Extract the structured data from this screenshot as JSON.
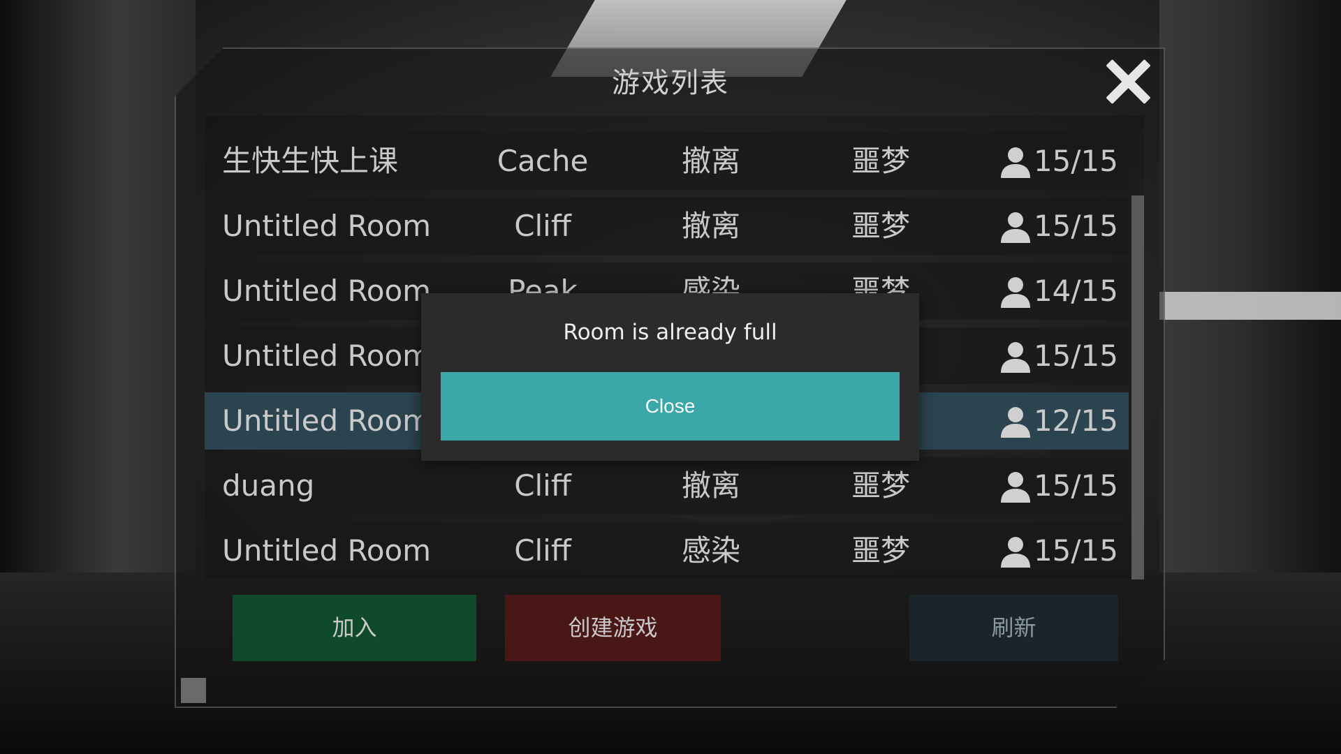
{
  "panel": {
    "title": "游戏列表"
  },
  "rooms": [
    {
      "name": "生快生快上课",
      "map": "Cache",
      "mode": "撤离",
      "difficulty": "噩梦",
      "players": "15/15",
      "selected": false
    },
    {
      "name": "Untitled Room",
      "map": "Cliff",
      "mode": "撤离",
      "difficulty": "噩梦",
      "players": "15/15",
      "selected": false
    },
    {
      "name": "Untitled Room",
      "map": "Peak",
      "mode": "感染",
      "difficulty": "噩梦",
      "players": "14/15",
      "selected": false
    },
    {
      "name": "Untitled Room",
      "map": "",
      "mode": "",
      "difficulty": "",
      "players": "15/15",
      "selected": false
    },
    {
      "name": "Untitled Room",
      "map": "",
      "mode": "",
      "difficulty": "",
      "players": "12/15",
      "selected": true
    },
    {
      "name": "duang",
      "map": "Cliff",
      "mode": "撤离",
      "difficulty": "噩梦",
      "players": "15/15",
      "selected": false
    },
    {
      "name": "Untitled Room",
      "map": "Cliff",
      "mode": "感染",
      "difficulty": "噩梦",
      "players": "15/15",
      "selected": false
    }
  ],
  "buttons": {
    "join": "加入",
    "create": "创建游戏",
    "refresh": "刷新"
  },
  "modal": {
    "message": "Room is already full",
    "close_label": "Close"
  },
  "colors": {
    "join": "#0f4a2a",
    "create": "#4a1717",
    "refresh": "#1b2428",
    "selected_row": "#2d4854",
    "modal_button": "#3aa8a8"
  },
  "icons": {
    "close": "close-x-icon",
    "player": "user-icon"
  }
}
